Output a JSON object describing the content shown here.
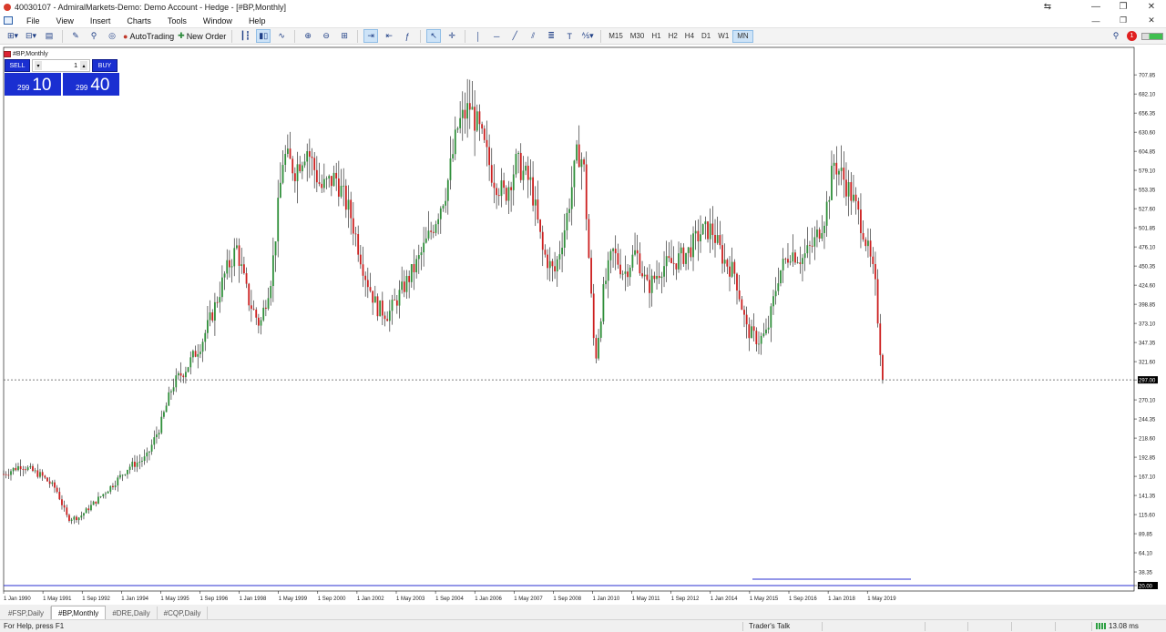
{
  "window": {
    "title": "40030107 - AdmiralMarkets-Demo: Demo Account - Hedge - [#BP,Monthly]",
    "controls": [
      "minimize",
      "restore",
      "close"
    ]
  },
  "menu": [
    "File",
    "View",
    "Insert",
    "Charts",
    "Tools",
    "Window",
    "Help"
  ],
  "toolbar": {
    "autotrading_label": "AutoTrading",
    "new_order_label": "New Order",
    "timeframes": [
      "M15",
      "M30",
      "H1",
      "H2",
      "H4",
      "D1",
      "W1",
      "MN"
    ],
    "active_timeframe": "MN",
    "alert_count": "1"
  },
  "chart": {
    "title": "#BP,Monthly",
    "one_click": {
      "sell_label": "SELL",
      "buy_label": "BUY",
      "lot": "1",
      "sell_small": "299",
      "sell_big": "10",
      "buy_small": "299",
      "buy_big": "40"
    },
    "current_price_label": "297.00"
  },
  "chart_data": {
    "type": "candlestick",
    "title": "#BP,Monthly",
    "ylim": [
      20.0,
      735.0
    ],
    "y_ticks": [
      "707.85",
      "682.10",
      "656.35",
      "630.60",
      "604.85",
      "579.10",
      "553.35",
      "527.60",
      "501.85",
      "476.10",
      "450.35",
      "424.60",
      "398.85",
      "373.10",
      "347.35",
      "321.60",
      "297.00",
      "270.10",
      "244.35",
      "218.60",
      "192.85",
      "167.10",
      "141.35",
      "115.60",
      "89.85",
      "64.10",
      "38.35",
      "20.00"
    ],
    "x_ticks": [
      "1 Jan 1990",
      "1 May 1991",
      "1 Sep 1992",
      "1 Jan 1994",
      "1 May 1995",
      "1 Sep 1996",
      "1 Jan 1998",
      "1 May 1999",
      "1 Sep 2000",
      "1 Jan 2002",
      "1 May 2003",
      "1 Sep 2004",
      "1 Jan 2006",
      "1 May 2007",
      "1 Sep 2008",
      "1 Jan 2010",
      "1 May 2011",
      "1 Sep 2012",
      "1 Jan 2014",
      "1 May 2015",
      "1 Sep 2016",
      "1 Jan 2018",
      "1 May 2019"
    ],
    "current_price": 297.0,
    "bull_color": "#2f8f3a",
    "bear_color": "#cc1f1f",
    "close_path": [
      [
        1990.0,
        170
      ],
      [
        1990.6,
        182
      ],
      [
        1991.3,
        168
      ],
      [
        1991.8,
        150
      ],
      [
        1992.2,
        110
      ],
      [
        1992.6,
        112
      ],
      [
        1993.2,
        135
      ],
      [
        1993.8,
        158
      ],
      [
        1994.3,
        180
      ],
      [
        1994.9,
        192
      ],
      [
        1995.4,
        238
      ],
      [
        1995.8,
        290
      ],
      [
        1996.3,
        315
      ],
      [
        1996.8,
        348
      ],
      [
        1997.2,
        390
      ],
      [
        1997.6,
        440
      ],
      [
        1998.0,
        475
      ],
      [
        1998.4,
        405
      ],
      [
        1998.8,
        370
      ],
      [
        1999.2,
        440
      ],
      [
        1999.6,
        600
      ],
      [
        2000.0,
        580
      ],
      [
        2000.4,
        610
      ],
      [
        2000.9,
        555
      ],
      [
        2001.4,
        570
      ],
      [
        2001.9,
        520
      ],
      [
        2002.4,
        440
      ],
      [
        2002.8,
        395
      ],
      [
        2003.2,
        385
      ],
      [
        2003.7,
        420
      ],
      [
        2004.2,
        455
      ],
      [
        2004.7,
        500
      ],
      [
        2005.2,
        555
      ],
      [
        2005.6,
        640
      ],
      [
        2006.0,
        665
      ],
      [
        2006.3,
        635
      ],
      [
        2006.8,
        570
      ],
      [
        2007.2,
        545
      ],
      [
        2007.6,
        590
      ],
      [
        2008.1,
        560
      ],
      [
        2008.5,
        470
      ],
      [
        2008.9,
        440
      ],
      [
        2009.3,
        510
      ],
      [
        2009.7,
        605
      ],
      [
        2009.9,
        590
      ],
      [
        2010.1,
        450
      ],
      [
        2010.3,
        320
      ],
      [
        2010.6,
        420
      ],
      [
        2010.9,
        470
      ],
      [
        2011.3,
        440
      ],
      [
        2011.7,
        470
      ],
      [
        2012.1,
        420
      ],
      [
        2012.6,
        450
      ],
      [
        2013.0,
        455
      ],
      [
        2013.5,
        470
      ],
      [
        2013.9,
        495
      ],
      [
        2014.3,
        500
      ],
      [
        2014.7,
        460
      ],
      [
        2015.1,
        440
      ],
      [
        2015.5,
        365
      ],
      [
        2015.9,
        350
      ],
      [
        2016.2,
        360
      ],
      [
        2016.6,
        440
      ],
      [
        2017.0,
        470
      ],
      [
        2017.4,
        460
      ],
      [
        2017.8,
        480
      ],
      [
        2018.2,
        520
      ],
      [
        2018.5,
        590
      ],
      [
        2018.8,
        570
      ],
      [
        2019.1,
        545
      ],
      [
        2019.5,
        500
      ],
      [
        2019.9,
        430
      ],
      [
        2020.1,
        330
      ],
      [
        2020.2,
        297
      ]
    ]
  },
  "tabs": [
    {
      "label": "#FSP,Daily",
      "active": false
    },
    {
      "label": "#BP,Monthly",
      "active": true
    },
    {
      "label": "#DRE,Daily",
      "active": false
    },
    {
      "label": "#CQP,Daily",
      "active": false
    }
  ],
  "status": {
    "help": "For Help, press F1",
    "profile": "Trader's Talk",
    "ping": "13.08 ms"
  }
}
